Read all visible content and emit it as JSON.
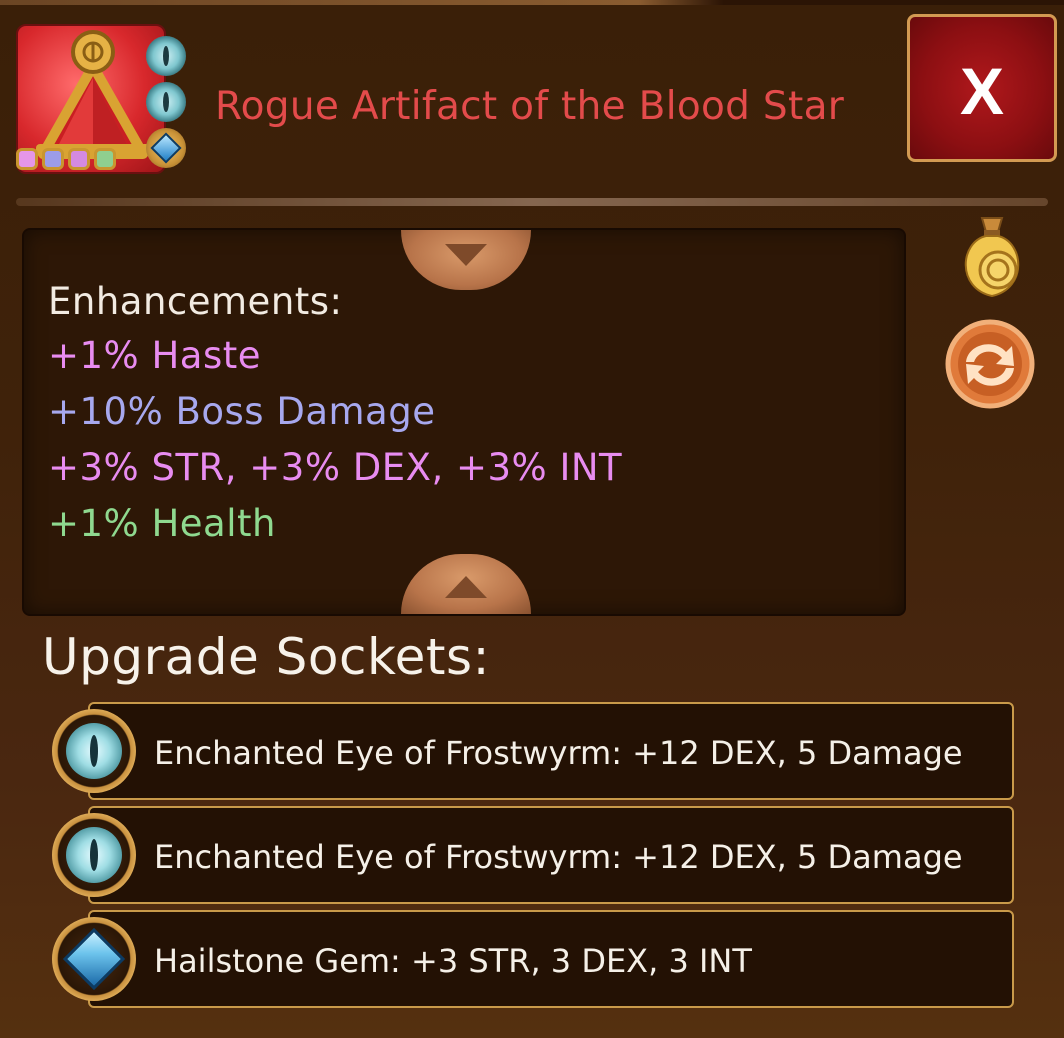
{
  "item": {
    "title": "Rogue Artifact of the Blood Star",
    "icon": "red-artifact-pyramid-icon",
    "rarity_dot_colors": [
      "#e596e8",
      "#9c9ce8",
      "#d48ae0",
      "#8fcf8f"
    ],
    "mini_sockets": [
      "frostwyrm-eye-icon",
      "frostwyrm-eye-icon",
      "hailstone-gem-icon"
    ]
  },
  "close_button": {
    "label": "X"
  },
  "enhancements": {
    "heading": "Enhancements:",
    "lines": [
      {
        "text": "+1% Haste",
        "color": "#e88cf0"
      },
      {
        "text": "+10% Boss Damage",
        "color": "#a7a8ee"
      },
      {
        "text": "+3% STR, +3% DEX, +3% INT",
        "color": "#e88cf0"
      },
      {
        "text": "+1% Health",
        "color": "#8fd98f"
      }
    ]
  },
  "side_icons": {
    "sell": "coin-bag-icon",
    "swap": "swap-arrows-icon"
  },
  "sockets": {
    "heading": "Upgrade Sockets:",
    "items": [
      {
        "icon": "frostwyrm-eye-icon",
        "text": "Enchanted Eye of Frostwyrm: +12 DEX, 5 Damage"
      },
      {
        "icon": "frostwyrm-eye-icon",
        "text": "Enchanted Eye of Frostwyrm: +12 DEX, 5 Damage"
      },
      {
        "icon": "hailstone-gem-icon",
        "text": "Hailstone Gem: +3 STR, 3 DEX, 3 INT"
      }
    ]
  }
}
